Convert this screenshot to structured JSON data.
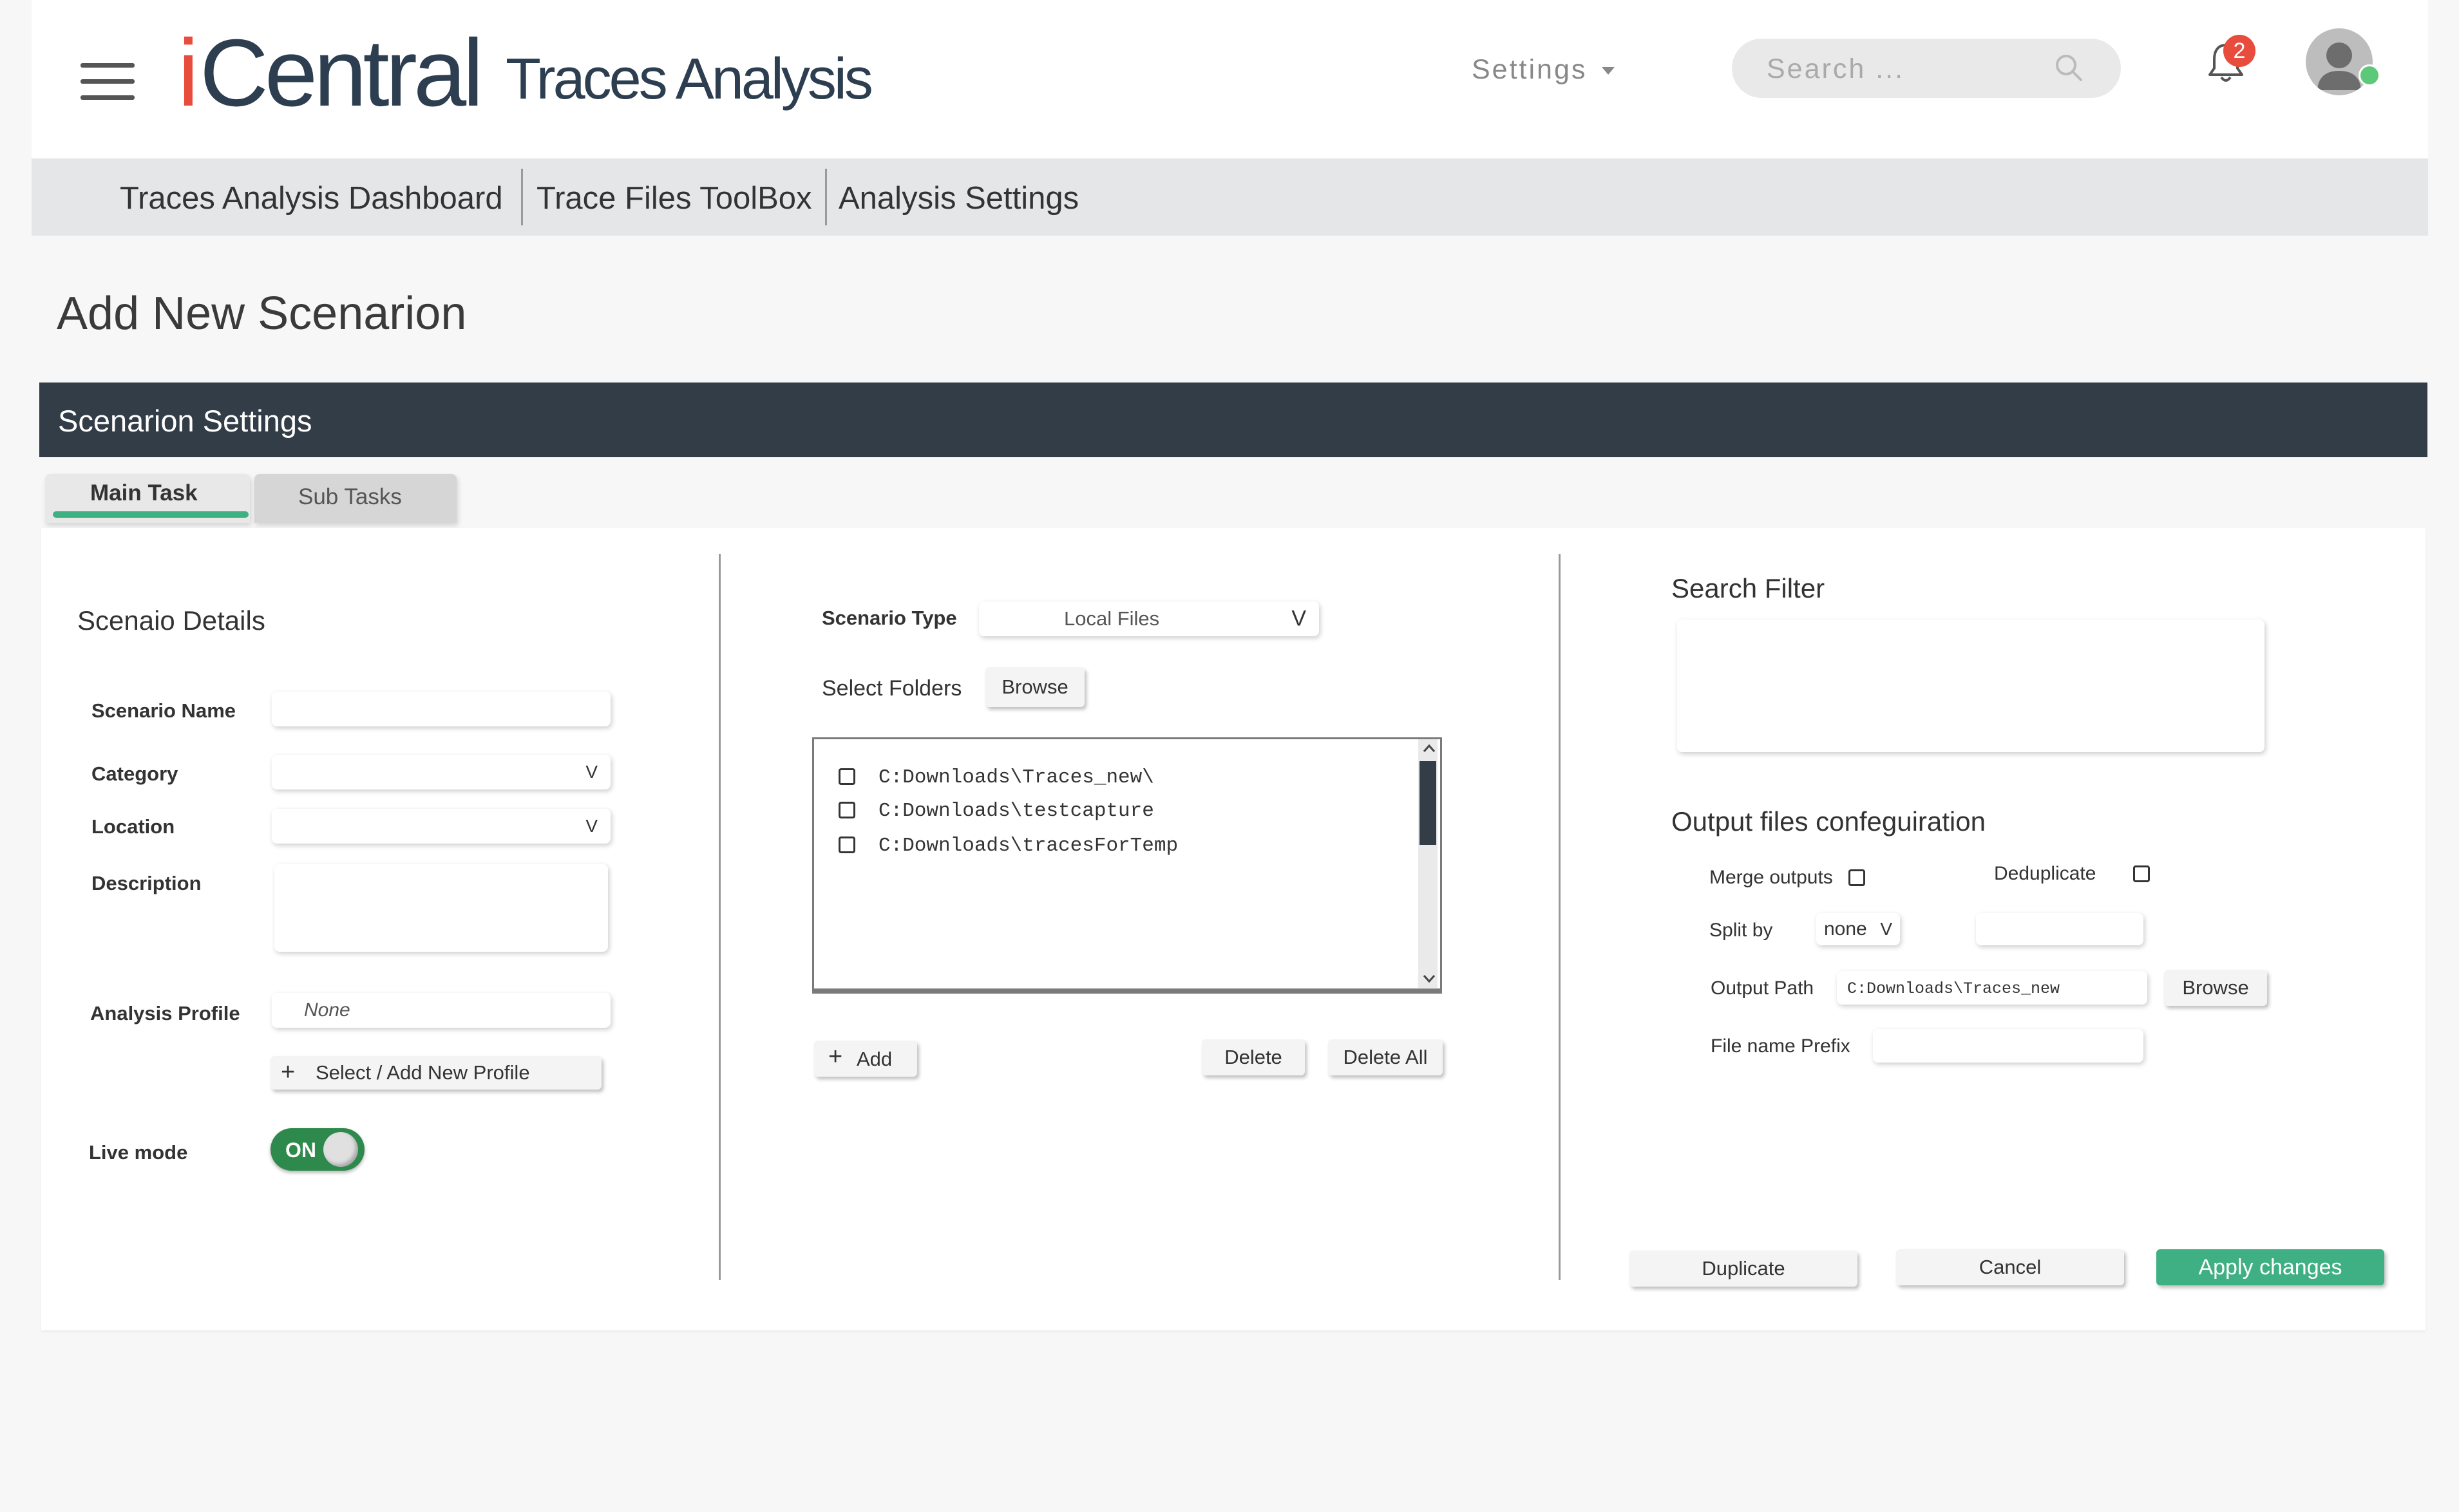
{
  "header": {
    "logo_i": "i",
    "logo_text": "Central",
    "app_title": "Traces Analysis",
    "settings_label": "Settings",
    "search_placeholder": "Search ...",
    "notification_count": "2"
  },
  "nav": {
    "items": [
      {
        "label": "Traces Analysis Dashboard"
      },
      {
        "label": "Trace Files ToolBox"
      },
      {
        "label": "Analysis Settings"
      }
    ]
  },
  "page": {
    "title": "Add New Scenarion"
  },
  "panel": {
    "title": "Scenarion Settings"
  },
  "tabs": {
    "main": "Main Task",
    "sub": "Sub Tasks"
  },
  "details": {
    "title": "Scenaio Details",
    "scenario_name_label": "Scenario Name",
    "category_label": "Category",
    "location_label": "Location",
    "description_label": "Description",
    "analysis_profile_label": "Analysis Profile",
    "analysis_profile_value": "None",
    "select_profile_button": "Select / Add New Profile",
    "live_mode_label": "Live mode",
    "live_mode_value": "ON",
    "dropdown_caret": "V"
  },
  "folders": {
    "scenario_type_label": "Scenario Type",
    "scenario_type_value": "Local Files",
    "scenario_type_caret": "V",
    "select_folders_label": "Select Folders",
    "browse_button": "Browse",
    "items": [
      {
        "path": "C:Downloads\\Traces_new\\"
      },
      {
        "path": "C:Downloads\\testcapture"
      },
      {
        "path": "C:Downloads\\tracesForTemp"
      }
    ],
    "add_button": "Add",
    "delete_button": "Delete",
    "delete_all_button": "Delete All"
  },
  "filter": {
    "title": "Search Filter"
  },
  "output": {
    "title": "Output files confeguiration",
    "merge_outputs_label": "Merge outputs",
    "deduplicate_label": "Deduplicate",
    "split_by_label": "Split by",
    "split_by_value": "none",
    "split_by_caret": "V",
    "output_path_label": "Output Path",
    "output_path_value": "C:Downloads\\Traces_new",
    "browse_button": "Browse",
    "file_prefix_label": "File name Prefix"
  },
  "actions": {
    "duplicate": "Duplicate",
    "cancel": "Cancel",
    "apply": "Apply changes"
  },
  "colors": {
    "brand_red": "#e74c3c",
    "brand_dark": "#2c3e4f",
    "panel_header": "#333d47",
    "accent_green": "#3fb083",
    "toggle_green": "#2e8a4c"
  }
}
